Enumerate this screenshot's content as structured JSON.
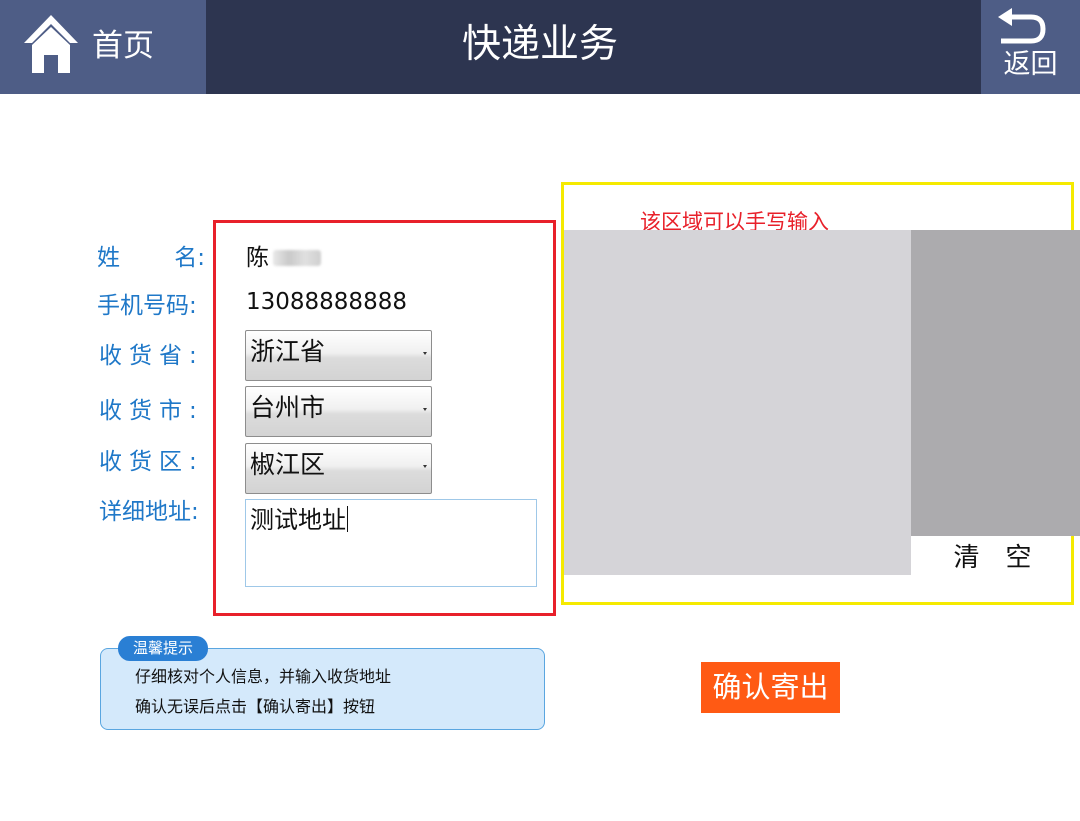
{
  "header": {
    "home_label": "首页",
    "title": "快递业务",
    "back_label": "返回",
    "bar_color": "#2d3550",
    "button_color": "#4e5d86"
  },
  "form": {
    "name_label_a": "姓",
    "name_label_b": "名:",
    "phone_label": "手机号码:",
    "province_label": "收货省:",
    "city_label": "收货市:",
    "district_label": "收货区:",
    "address_label": "详细地址:",
    "name_value": "陈",
    "phone_value": "13088888888",
    "province_value": "浙江省",
    "city_value": "台州市",
    "district_value": "椒江区",
    "address_value": "测试地址",
    "label_color": "#1f78c8",
    "frame_color": "#e8202a"
  },
  "handwriting": {
    "hint": "该区域可以手写输入",
    "clear_label": "清空",
    "frame_color": "#f5ea00",
    "hint_color": "#e8202a"
  },
  "tip": {
    "badge": "温馨提示",
    "line1": "仔细核对个人信息，并输入收货地址",
    "line2": "确认无误后点击【确认寄出】按钮"
  },
  "confirm": {
    "label": "确认寄出",
    "color": "#ff5a14"
  },
  "icons": {
    "home": "home-icon",
    "back": "back-arrow-icon",
    "dropdown": "chevron-down-icon"
  }
}
